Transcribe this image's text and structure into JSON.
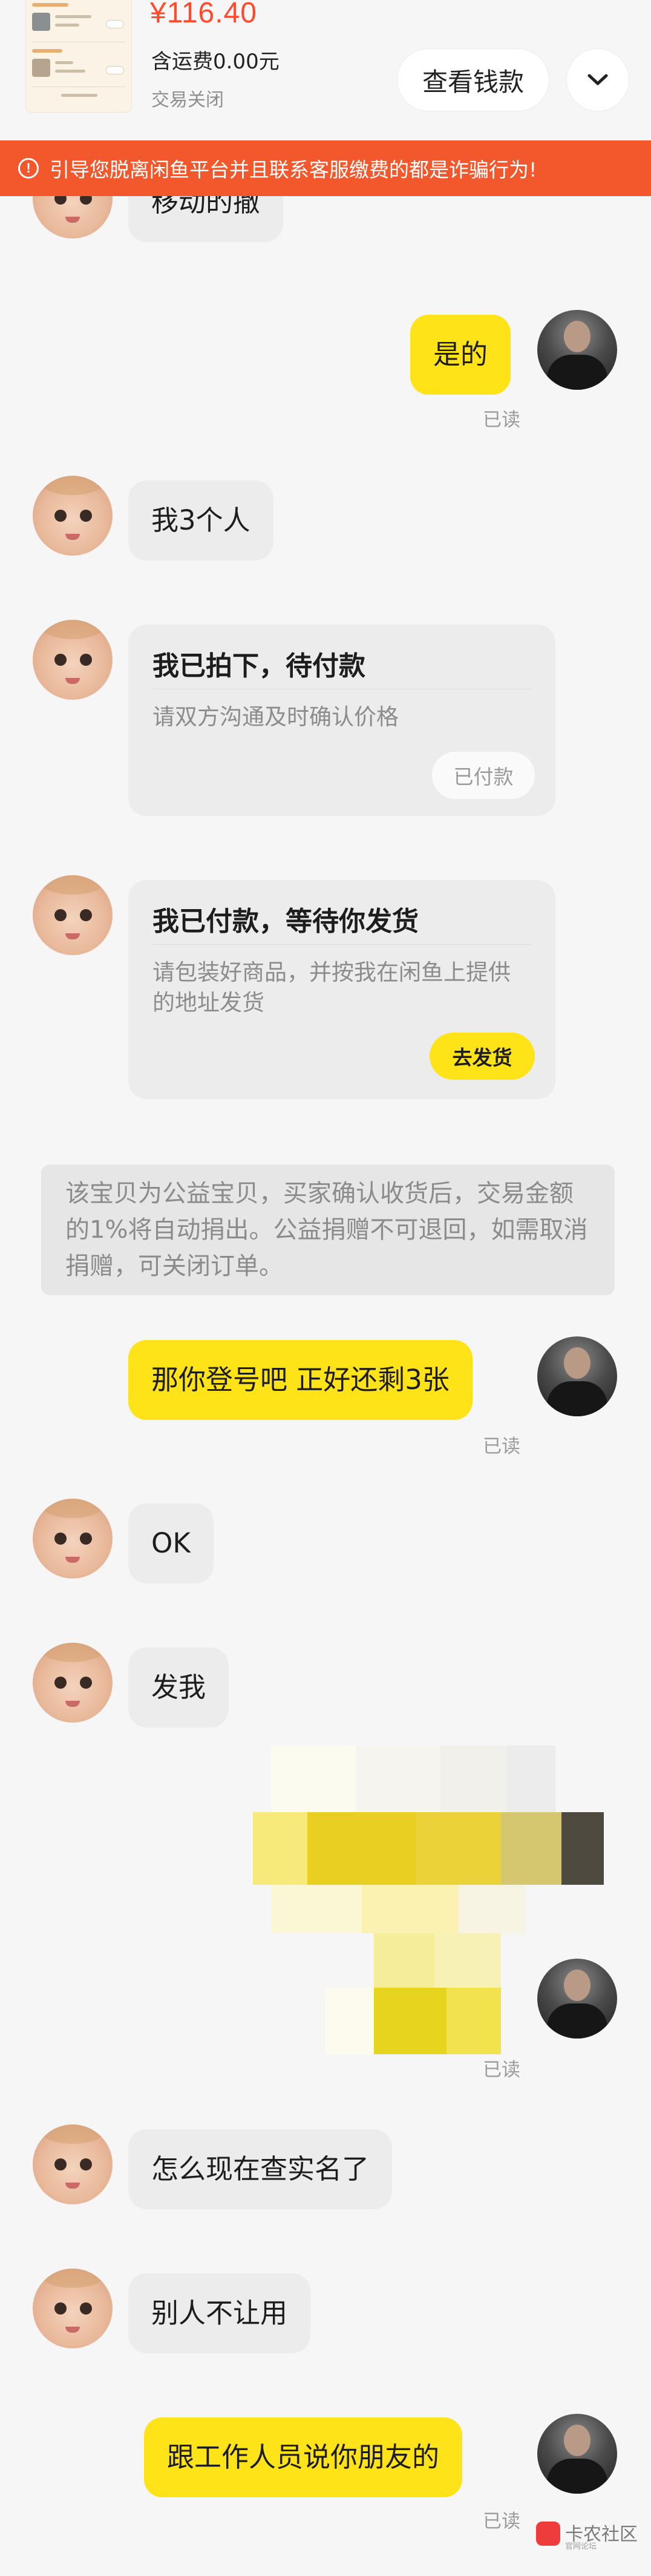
{
  "order": {
    "price": "¥116.40",
    "shipping": "含运费0.00元",
    "status": "交易关闭",
    "view_money_label": "查看钱款",
    "thumbnail_texts": []
  },
  "warning": {
    "text": "引导您脱离闲鱼平台并且联系客服缴费的都是诈骗行为!",
    "icon": "info-circle-icon"
  },
  "messages": {
    "m1": "移动的撤",
    "m2": "是的",
    "m2_read": "已读",
    "m3": "我3个人",
    "m4": "那你登号吧 正好还剩3张",
    "m4_read": "已读",
    "m5": "OK",
    "m6": "发我",
    "m7_read": "已读",
    "m8": "怎么现在查实名了",
    "m9": "别人不让用",
    "m10": "跟工作人员说你朋友的",
    "m10_read": "已读"
  },
  "cards": {
    "c1": {
      "title": "我已拍下，待付款",
      "desc": "请双方沟通及时确认价格",
      "action": "已付款"
    },
    "c2": {
      "title": "我已付款，等待你发货",
      "desc": "请包装好商品，并按我在闲鱼上提供的地址发货",
      "action": "去发货"
    }
  },
  "system_notice": "该宝贝为公益宝贝，买家确认收货后，交易金额的1%将自动捐出。公益捐赠不可退回，如需取消捐赠，可关闭订单。",
  "watermark": {
    "text": "卡农社区",
    "sub": "官网论坛"
  },
  "colors": {
    "accent_yellow": "#ffe319",
    "price_red": "#ff4a2e",
    "warning_orange": "#f2582b"
  }
}
